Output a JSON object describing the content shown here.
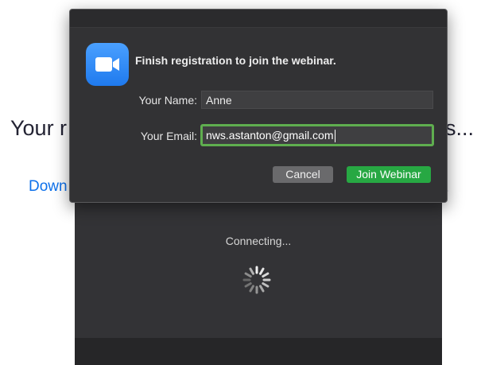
{
  "background_page": {
    "heading_left": "Your r",
    "heading_right": "s...",
    "link_left": "Down",
    "link_right": "."
  },
  "connecting_window": {
    "status_text": "Connecting..."
  },
  "dialog": {
    "title": "Finish registration to join the webinar.",
    "name_label": "Your Name:",
    "name_value": "Anne",
    "email_label": "Your Email:",
    "email_value": "nws.astanton@gmail.com",
    "cancel_label": "Cancel",
    "join_label": "Join Webinar",
    "app_icon": "zoom-video-camera-icon"
  },
  "colors": {
    "join_button": "#27a843",
    "focus_ring": "#5fae4f",
    "app_icon_blue": "#2d8cff",
    "link_blue": "#0e71eb"
  }
}
